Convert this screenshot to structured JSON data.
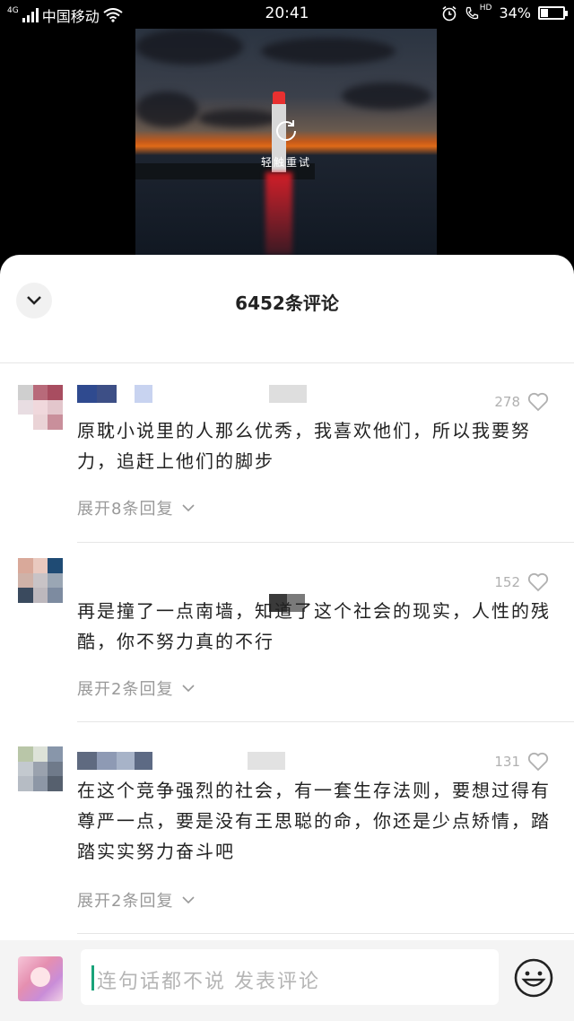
{
  "status_bar": {
    "network": "4G",
    "carrier": "中国移动",
    "time": "20:41",
    "hd": "HD",
    "battery_percent": "34%",
    "battery_level": 0.34
  },
  "video": {
    "reload_label": "轻触重试"
  },
  "comments_header": {
    "title": "6452条评论"
  },
  "comments": [
    {
      "likes": "278",
      "text": "原耽小说里的人那么优秀，我喜欢他们，所以我要努力，追赶上他们的脚步",
      "replies": "展开8条回复"
    },
    {
      "likes": "152",
      "text": "再是撞了一点南墙，知道了这个社会的现实，人性的残酷，你不努力真的不行",
      "replies": "展开2条回复"
    },
    {
      "likes": "131",
      "text": "在这个竞争强烈的社会，有一套生存法则，要想过得有尊严一点，要是没有王思聪的命，你还是少点矫情，踏踏实实努力奋斗吧",
      "replies": "展开2条回复"
    }
  ],
  "input_bar": {
    "placeholder": "连句话都不说 发表评论"
  }
}
